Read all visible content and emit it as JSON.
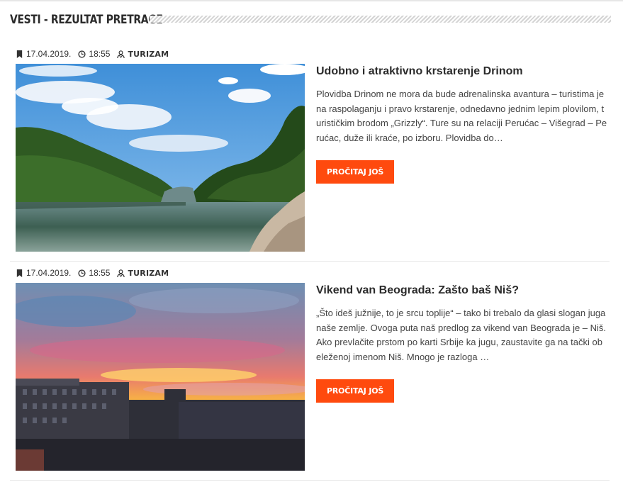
{
  "section": {
    "title": "VESTI - REZULTAT PRETRAGE"
  },
  "articles": [
    {
      "date": "17.04.2019.",
      "time": "18:55",
      "category": "TURIZAM",
      "title": "Udobno i atraktivno krstarenje Drinom",
      "excerpt": "Plovidba Drinom ne mora da bude adrenalinska avantura – turistima je na raspolaganju i pravo krstarenje, odnedavno jednim lepim plovilom, turističkim brodom „Grizzly“. Ture su na relaciji Perućac – Višegrad – Perućac, duže ili kraće, po izboru. Plovidba do…",
      "read_more": "PROČITAJ JOŠ",
      "image": "river-landscape-image"
    },
    {
      "date": "17.04.2019.",
      "time": "18:55",
      "category": "TURIZAM",
      "title": "Vikend van Beograda: Zašto baš Niš?",
      "excerpt": "„Što ideš južnije, to je srcu toplije“ – tako bi trebalo da glasi slogan juga naše zemlje. Ovoga puta naš predlog za vikend van Beograda je – Niš.Ako prevlačite prstom po karti Srbije ka jugu, zaustavite ga na tački obeleženoj imenom Niš. Mnogo je razloga …",
      "read_more": "PROČITAJ JOŠ",
      "image": "sunset-city-image"
    }
  ],
  "icons": {
    "date": "bookmark-icon",
    "time": "clock-icon",
    "category": "user-icon"
  },
  "colors": {
    "accent": "#ff4a0e",
    "text": "#333333",
    "divider": "#e8e8e8"
  }
}
